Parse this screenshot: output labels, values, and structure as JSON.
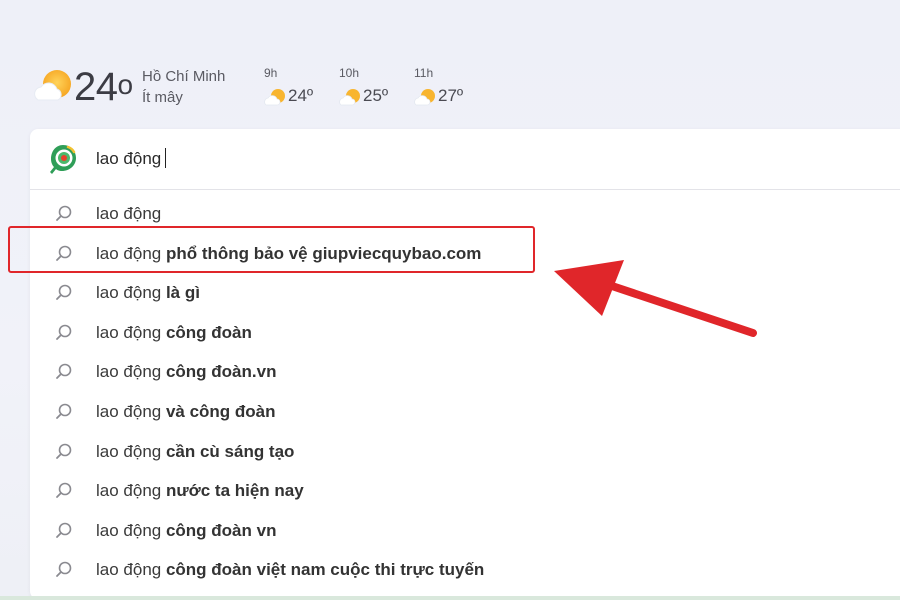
{
  "weather": {
    "icon": "partly-sunny-icon",
    "temperature": "24",
    "degree": "o",
    "city": "Hồ Chí Minh",
    "condition": "Ít mây",
    "hourly": [
      {
        "time": "9h",
        "temp": "24º",
        "icon": "partly-sunny-icon"
      },
      {
        "time": "10h",
        "temp": "25º",
        "icon": "partly-sunny-icon"
      },
      {
        "time": "11h",
        "temp": "27º",
        "icon": "partly-sunny-icon"
      }
    ]
  },
  "search": {
    "logo": "browser-logo-icon",
    "query": "lao động"
  },
  "suggestions": [
    {
      "prefix": "lao động",
      "completion": ""
    },
    {
      "prefix": "lao động ",
      "completion": "phổ thông bảo vệ giupviecquybao.com"
    },
    {
      "prefix": "lao động ",
      "completion": "là gì"
    },
    {
      "prefix": "lao động ",
      "completion": "công đoàn"
    },
    {
      "prefix": "lao động ",
      "completion": "công đoàn.vn"
    },
    {
      "prefix": "lao động ",
      "completion": "và công đoàn"
    },
    {
      "prefix": "lao động ",
      "completion": "cần cù sáng tạo"
    },
    {
      "prefix": "lao động ",
      "completion": "nước ta hiện nay"
    },
    {
      "prefix": "lao động ",
      "completion": "công đoàn vn"
    },
    {
      "prefix": "lao động ",
      "completion": "công đoàn việt nam cuộc thi trực tuyến"
    }
  ],
  "annotation": {
    "highlight_color": "#e0262a",
    "highlighted_suggestion": 1
  }
}
